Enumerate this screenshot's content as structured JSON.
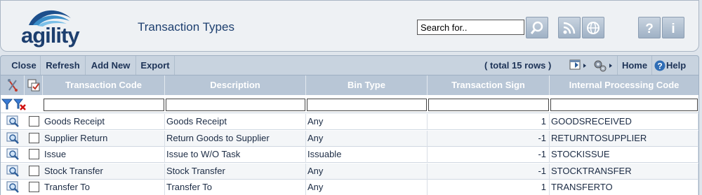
{
  "app": {
    "logo_text": "agility",
    "page_title": "Transaction Types"
  },
  "search": {
    "value": "Search for.."
  },
  "header_icons": [
    "search-icon",
    "rss-icon",
    "globe-icon",
    "help-icon",
    "info-icon"
  ],
  "toolbar": {
    "close": "Close",
    "refresh": "Refresh",
    "add_new": "Add New",
    "export": "Export",
    "rows_info": "( total 15 rows )",
    "home": "Home",
    "help": "Help"
  },
  "grid": {
    "columns": [
      "Transaction Code",
      "Description",
      "Bin Type",
      "Transaction Sign",
      "Internal Processing Code"
    ],
    "rows": [
      {
        "code": "Goods Receipt",
        "description": "Goods Receipt",
        "bin_type": "Any",
        "sign": "1",
        "internal": "GOODSRECEIVED"
      },
      {
        "code": "Supplier Return",
        "description": "Return Goods to Supplier",
        "bin_type": "Any",
        "sign": "-1",
        "internal": "RETURNTOSUPPLIER"
      },
      {
        "code": "Issue",
        "description": "Issue to W/O Task",
        "bin_type": "Issuable",
        "sign": "-1",
        "internal": "STOCKISSUE"
      },
      {
        "code": "Stock Transfer",
        "description": "Stock Transfer",
        "bin_type": "Any",
        "sign": "-1",
        "internal": "STOCKTRANSFER"
      },
      {
        "code": "Transfer To",
        "description": "Transfer To",
        "bin_type": "Any",
        "sign": "1",
        "internal": "TRANSFERTO"
      }
    ]
  },
  "colors": {
    "brand_navy": "#1d3f6f",
    "header_bg": "#b8c6d6",
    "toolbar_bg": "#c8d3df"
  }
}
